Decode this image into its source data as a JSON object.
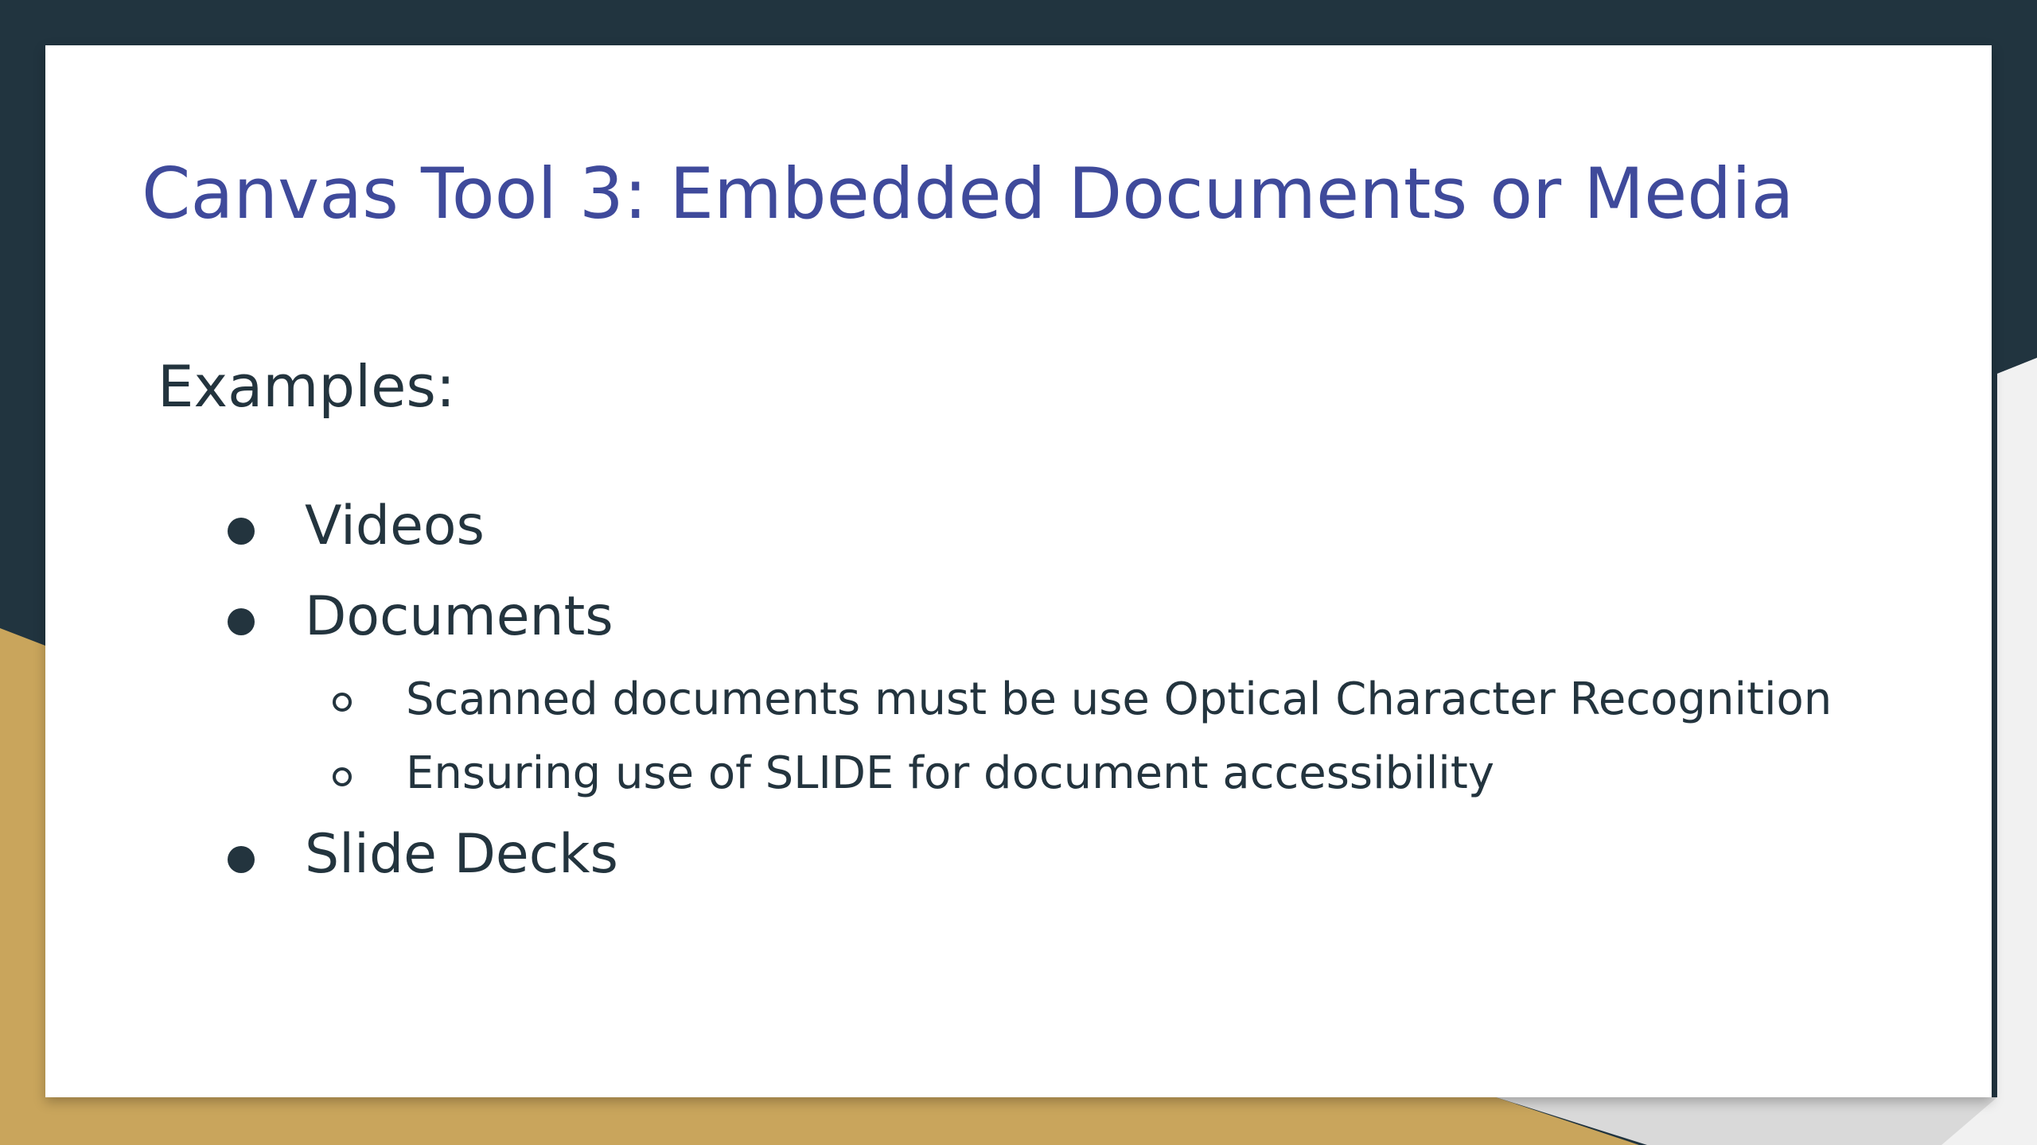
{
  "slide": {
    "title": "Canvas Tool 3: Embedded Documents or Media",
    "intro": "Examples:",
    "items": [
      {
        "label": "Videos"
      },
      {
        "label": "Documents",
        "subitems": [
          {
            "label": "Scanned documents must be use Optical Character Recognition"
          },
          {
            "label": "Ensuring use of SLIDE for document accessibility"
          }
        ]
      },
      {
        "label": "Slide Decks"
      }
    ]
  },
  "colors": {
    "navy": "#21343f",
    "gold": "#c9a55c",
    "title": "#3f4a9b",
    "text": "#23343e",
    "white": "#ffffff"
  },
  "icons": {
    "primary_bullet": "filled-circle-bullet-icon",
    "secondary_bullet": "hollow-circle-bullet-icon"
  }
}
